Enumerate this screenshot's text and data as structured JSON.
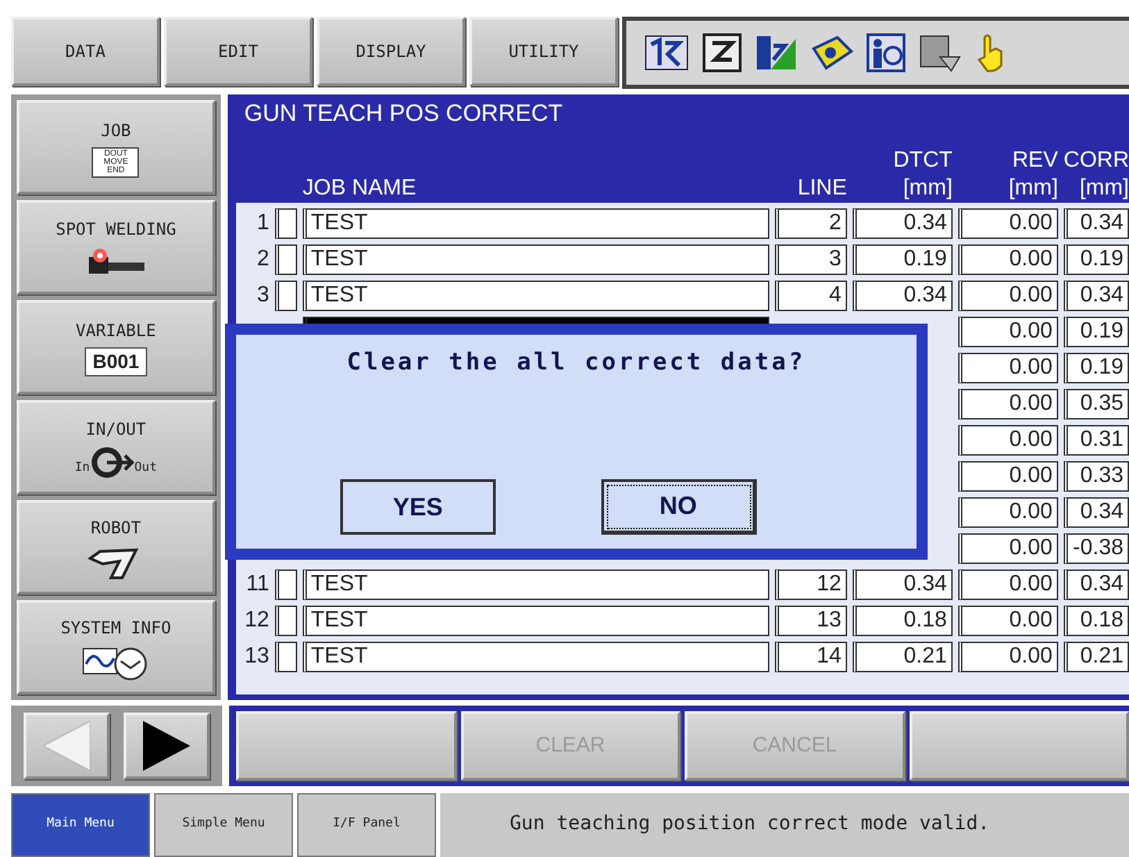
{
  "menu": [
    {
      "label": "DATA"
    },
    {
      "label": "EDIT"
    },
    {
      "label": "DISPLAY"
    },
    {
      "label": "UTILITY"
    }
  ],
  "sidebar": {
    "items": [
      {
        "label": "JOB",
        "kind": "job",
        "icon_lines": [
          "DOUT",
          "MOVE",
          "END"
        ]
      },
      {
        "label": "SPOT WELDING",
        "kind": "spot"
      },
      {
        "label": "VARIABLE",
        "kind": "variable",
        "value": "B001"
      },
      {
        "label": "IN/OUT",
        "kind": "inout",
        "icon_labels": [
          "In",
          "Out"
        ]
      },
      {
        "label": "ROBOT",
        "kind": "robot"
      },
      {
        "label": "SYSTEM INFO",
        "kind": "sysinfo"
      }
    ]
  },
  "screen": {
    "title": "GUN TEACH POS CORRECT",
    "columns": [
      {
        "label": "JOB NAME"
      },
      {
        "label": "LINE"
      },
      {
        "label": "DTCT",
        "unit": "[mm]"
      },
      {
        "label": "REV",
        "unit": "[mm]"
      },
      {
        "label": "CORR",
        "unit": "[mm]"
      }
    ],
    "rows": [
      {
        "no": "1",
        "job": "TEST",
        "line": "2",
        "dtct": "0.34",
        "rev": "0.00",
        "corr": "0.34",
        "selected": false
      },
      {
        "no": "2",
        "job": "TEST",
        "line": "3",
        "dtct": "0.19",
        "rev": "0.00",
        "corr": "0.19",
        "selected": false
      },
      {
        "no": "3",
        "job": "TEST",
        "line": "4",
        "dtct": "0.34",
        "rev": "0.00",
        "corr": "0.34",
        "selected": false
      },
      {
        "rev": "0.00",
        "corr": "0.19",
        "selected": true
      },
      {
        "rev": "0.00",
        "corr": "0.19",
        "selected": false
      },
      {
        "rev": "0.00",
        "corr": "0.35",
        "selected": false
      },
      {
        "rev": "0.00",
        "corr": "0.31",
        "selected": false
      },
      {
        "rev": "0.00",
        "corr": "0.33",
        "selected": false
      },
      {
        "rev": "0.00",
        "corr": "0.34",
        "selected": false
      },
      {
        "rev": "0.00",
        "corr": "-0.38",
        "selected": false
      },
      {
        "no": "11",
        "job": "TEST",
        "line": "12",
        "dtct": "0.34",
        "rev": "0.00",
        "corr": "0.34",
        "selected": false
      },
      {
        "no": "12",
        "job": "TEST",
        "line": "13",
        "dtct": "0.18",
        "rev": "0.00",
        "corr": "0.18",
        "selected": false
      },
      {
        "no": "13",
        "job": "TEST",
        "line": "14",
        "dtct": "0.21",
        "rev": "0.00",
        "corr": "0.21",
        "selected": false
      }
    ]
  },
  "dialog": {
    "message": "Clear the all correct data?",
    "buttons": [
      {
        "label": "YES",
        "focused": false
      },
      {
        "label": "NO",
        "focused": true
      }
    ]
  },
  "function_keys": [
    {
      "kind": "blank"
    },
    {
      "kind": "key",
      "label": "CLEAR",
      "disabled": true
    },
    {
      "kind": "key",
      "label": "CANCEL",
      "disabled": true
    },
    {
      "kind": "blank"
    }
  ],
  "bottom_tabs": [
    {
      "label": "Main Menu",
      "selected": true
    },
    {
      "label": "Simple Menu",
      "selected": false
    },
    {
      "label": "I/F Panel",
      "selected": false
    }
  ],
  "status_bar": {
    "message": "Gun teaching position correct mode valid."
  }
}
